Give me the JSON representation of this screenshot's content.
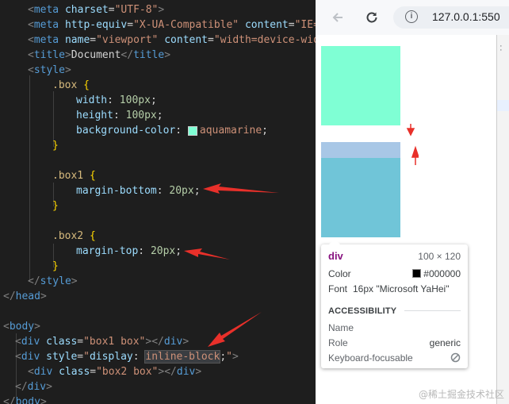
{
  "editor": {
    "code_lines": [
      "<meta charset=\"UTF-8\">",
      "<meta http-equiv=\"X-UA-Compatible\" content=\"IE=",
      "<meta name=\"viewport\" content=\"width=device-wid",
      "<title>Document</title>",
      "<style>",
      ".box {",
      "width: 100px;",
      "height: 100px;",
      "background-color: aquamarine;",
      "}",
      ".box1 {",
      "margin-bottom: 20px;",
      "}",
      ".box2 {",
      "margin-top: 20px;",
      "}",
      "</style>",
      "</head>",
      "<body>",
      "<div class=\"box1 box\"></div>",
      "<div style=\"display: inline-block;\">",
      "<div class=\"box2 box\"></div>",
      "</div>",
      "</body>"
    ],
    "swatch_color": "#7fffd4"
  },
  "browser": {
    "url": "127.0.0.1:550",
    "back_icon": "arrow-left-icon",
    "reload_icon": "reload-icon",
    "info_icon": "info-icon",
    "menu_icon": "more-vert-icon",
    "box_color": "#7fffd4",
    "margin_highlight_color": "#a8c7e6",
    "content_highlight_color": "#70c5d8"
  },
  "tooltip": {
    "element": "div",
    "size": "100 × 120",
    "color_label": "Color",
    "color_value": "#000000",
    "font_label": "Font",
    "font_value": "16px \"Microsoft YaHei\"",
    "accessibility_header": "ACCESSIBILITY",
    "name_label": "Name",
    "role_label": "Role",
    "role_value": "generic",
    "keyboard_label": "Keyboard-focusable"
  },
  "watermark": "@稀土掘金技术社区",
  "annotation_color": "#e8302a"
}
